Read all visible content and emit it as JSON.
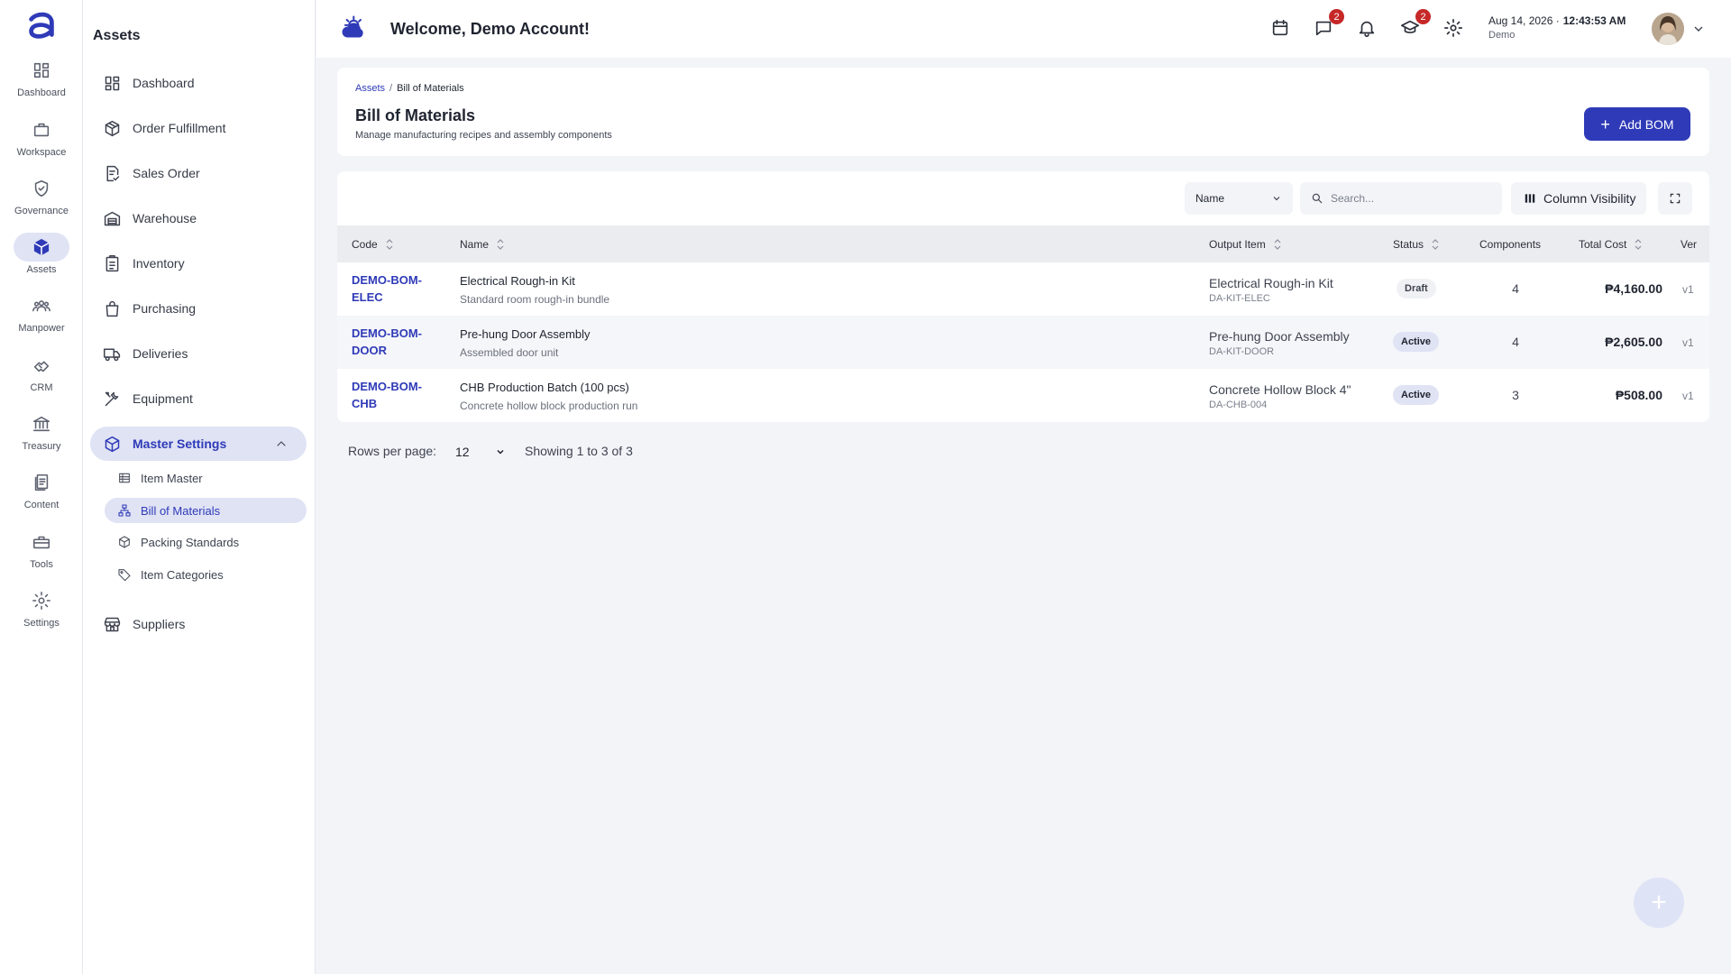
{
  "rail": {
    "items": [
      {
        "label": "Dashboard",
        "icon": "dashboard-icon"
      },
      {
        "label": "Workspace",
        "icon": "briefcase-icon"
      },
      {
        "label": "Governance",
        "icon": "shield-check-icon"
      },
      {
        "label": "Assets",
        "icon": "cube-icon"
      },
      {
        "label": "Manpower",
        "icon": "people-icon"
      },
      {
        "label": "CRM",
        "icon": "handshake-icon"
      },
      {
        "label": "Treasury",
        "icon": "bank-icon"
      },
      {
        "label": "Content",
        "icon": "documents-icon"
      },
      {
        "label": "Tools",
        "icon": "toolbox-icon"
      },
      {
        "label": "Settings",
        "icon": "gear-icon"
      }
    ]
  },
  "sidenav": {
    "title": "Assets",
    "items": [
      {
        "label": "Dashboard"
      },
      {
        "label": "Order Fulfillment"
      },
      {
        "label": "Sales Order"
      },
      {
        "label": "Warehouse"
      },
      {
        "label": "Inventory"
      },
      {
        "label": "Purchasing"
      },
      {
        "label": "Deliveries"
      },
      {
        "label": "Equipment"
      },
      {
        "label": "Master Settings"
      },
      {
        "label": "Suppliers"
      }
    ],
    "sub_items": [
      {
        "label": "Item Master"
      },
      {
        "label": "Bill of Materials"
      },
      {
        "label": "Packing Standards"
      },
      {
        "label": "Item Categories"
      }
    ]
  },
  "header": {
    "welcome": "Welcome, Demo Account!",
    "messages_badge": "2",
    "training_badge": "2",
    "date": "Aug 14, 2026 ·",
    "time": "12:43:53 AM",
    "org": "Demo"
  },
  "page": {
    "breadcrumb_root": "Assets",
    "breadcrumb_sep": "/",
    "breadcrumb_current": "Bill of Materials",
    "title": "Bill of Materials",
    "subtitle": "Manage manufacturing recipes and assembly components",
    "add_button": "Add BOM",
    "add_plus": "+"
  },
  "toolbar": {
    "filter_field": "Name",
    "search_placeholder": "Search...",
    "column_visibility": "Column Visibility"
  },
  "table": {
    "columns": {
      "code": "Code",
      "name": "Name",
      "output_item": "Output Item",
      "status": "Status",
      "components": "Components",
      "total_cost": "Total Cost",
      "ver": "Ver"
    },
    "rows": [
      {
        "code": "DEMO-BOM-ELEC",
        "name": "Electrical Rough-in Kit",
        "description": "Standard room rough-in bundle",
        "output_name": "Electrical Rough-in Kit",
        "output_code": "DA-KIT-ELEC",
        "status": "Draft",
        "components": "4",
        "total_cost": "₱4,160.00",
        "version": "v1"
      },
      {
        "code": "DEMO-BOM-DOOR",
        "name": "Pre-hung Door Assembly",
        "description": "Assembled door unit",
        "output_name": "Pre-hung Door Assembly",
        "output_code": "DA-KIT-DOOR",
        "status": "Active",
        "components": "4",
        "total_cost": "₱2,605.00",
        "version": "v1"
      },
      {
        "code": "DEMO-BOM-CHB",
        "name": "CHB Production Batch (100 pcs)",
        "description": "Concrete hollow block production run",
        "output_name": "Concrete Hollow Block 4\"",
        "output_code": "DA-CHB-004",
        "status": "Active",
        "components": "3",
        "total_cost": "₱508.00",
        "version": "v1"
      }
    ]
  },
  "pagination": {
    "rows_label": "Rows per page:",
    "rows_value": "12",
    "showing": "Showing 1 to 3 of 3"
  },
  "fab": {
    "label": "+"
  },
  "colors": {
    "accent": "#2f3ab8",
    "badge": "#c62828",
    "selected_bg": "#dfe3f4"
  }
}
